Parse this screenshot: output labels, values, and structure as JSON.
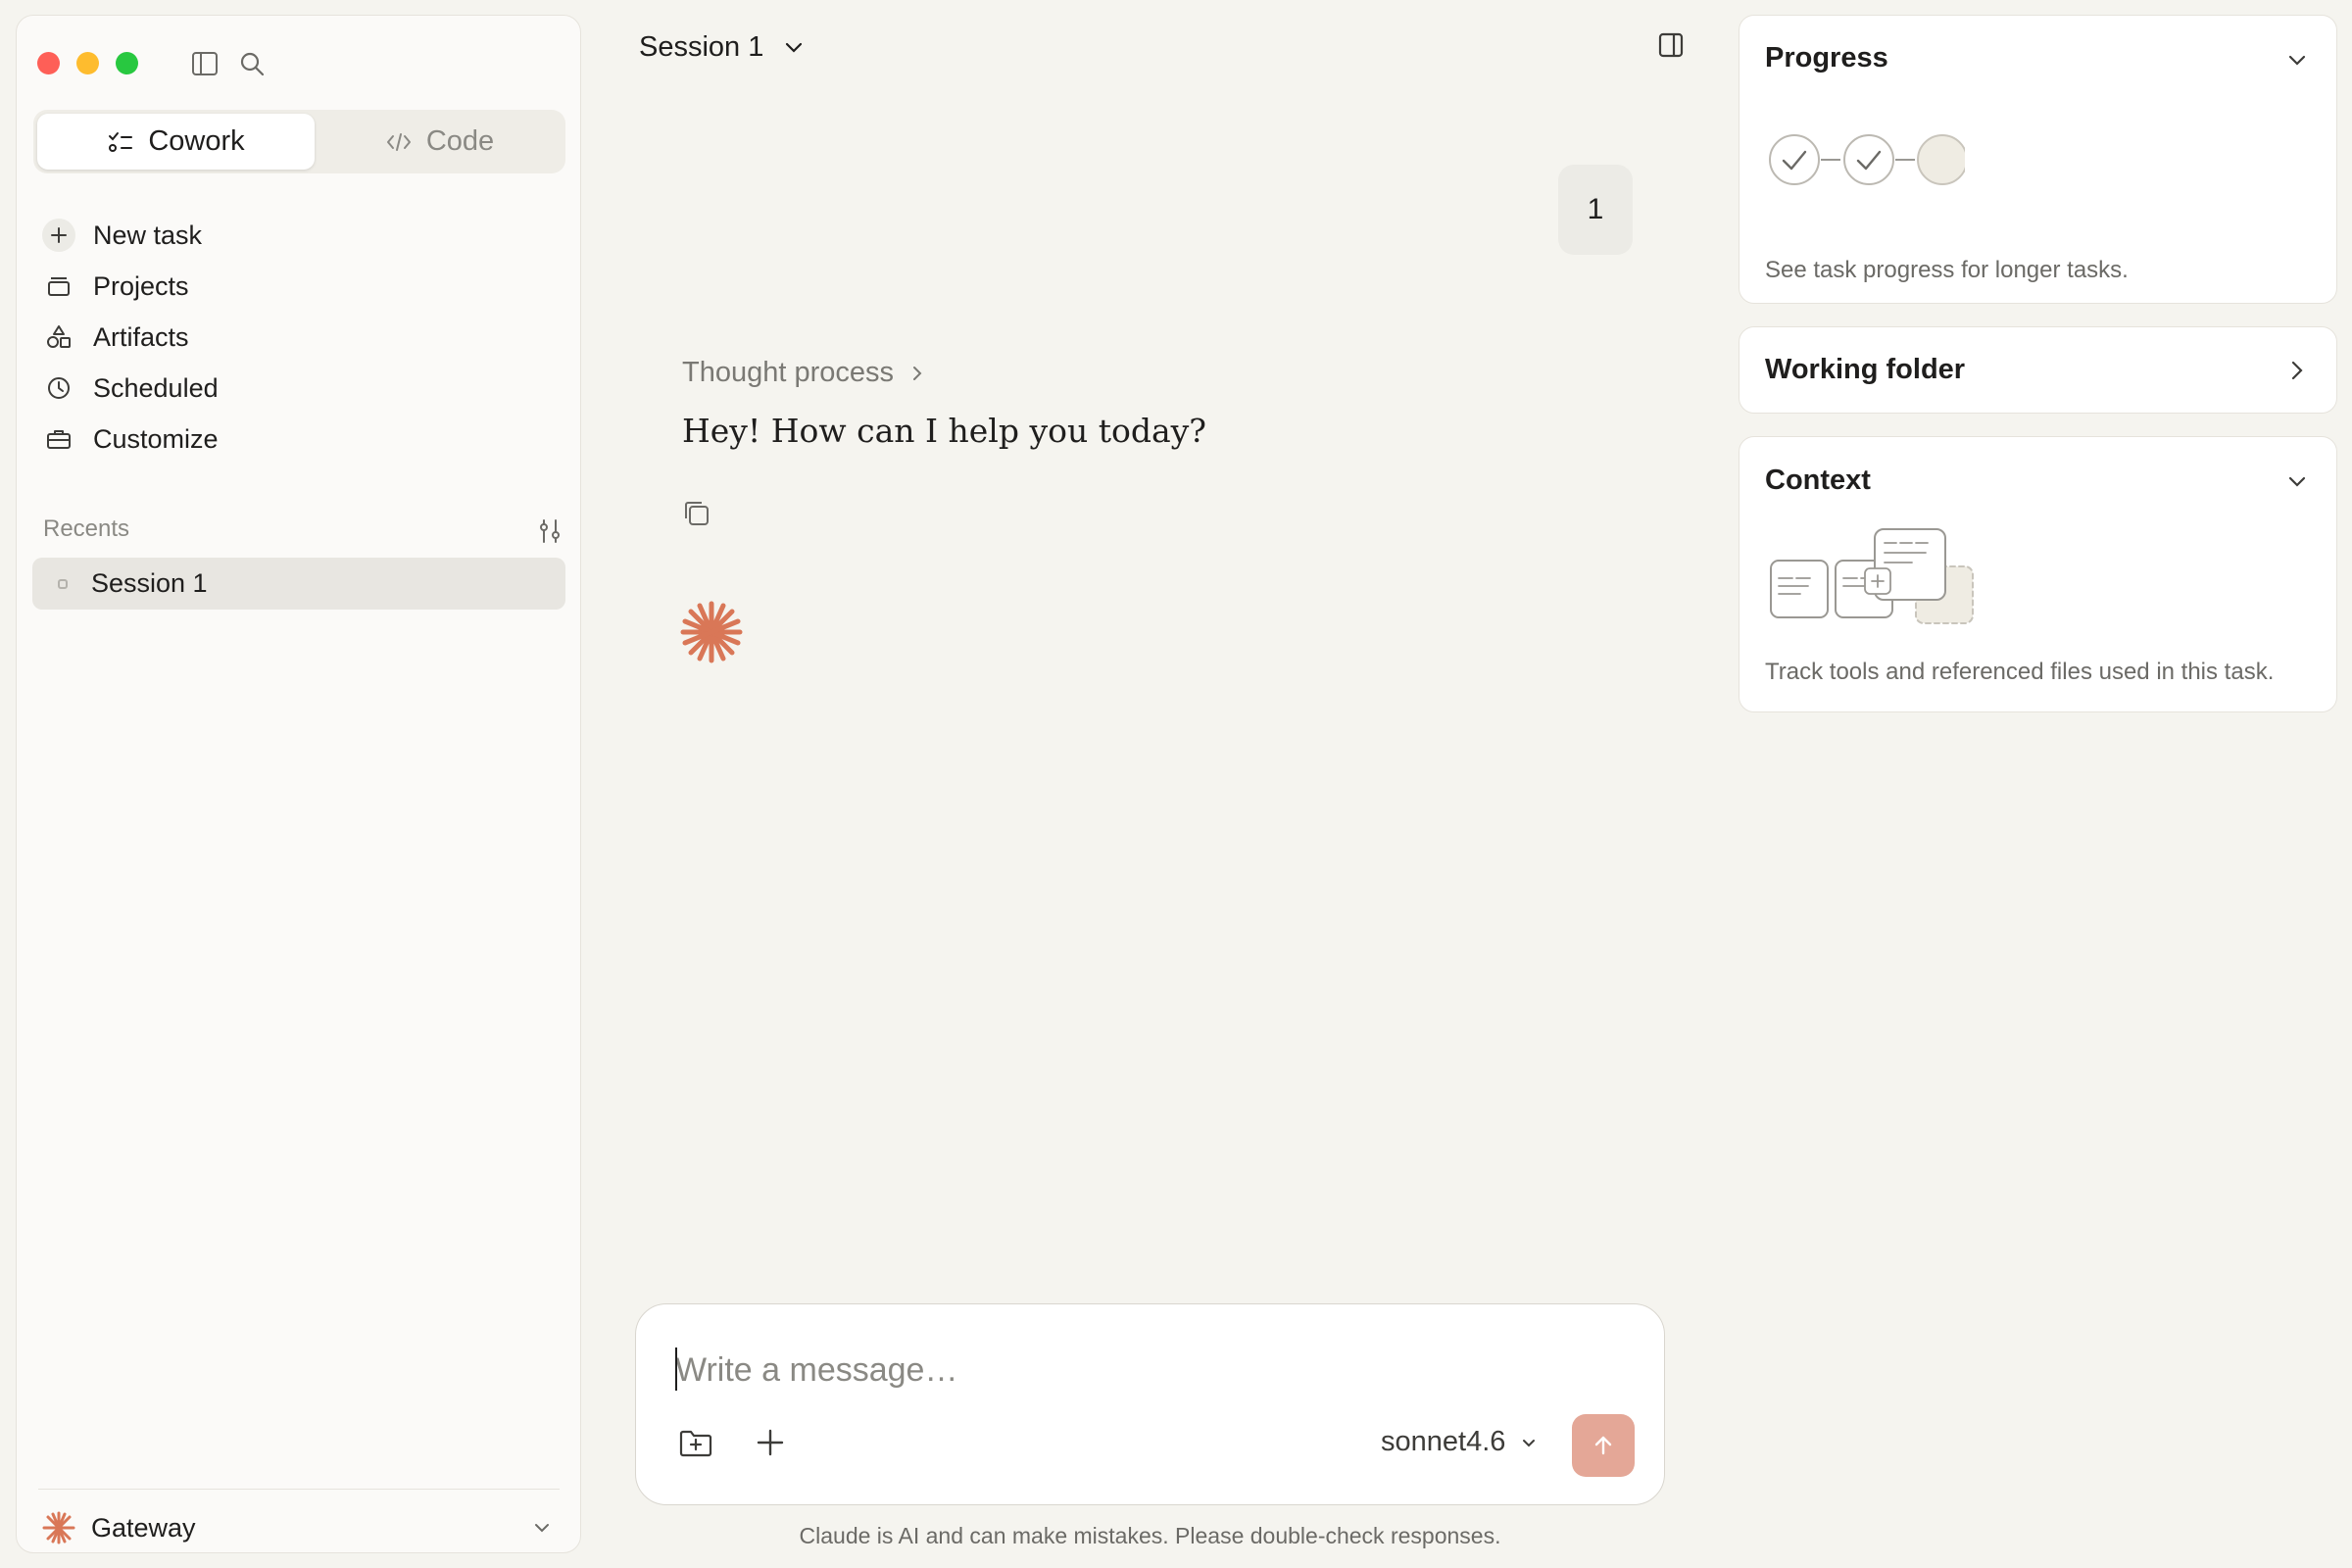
{
  "sidebar": {
    "modes": {
      "cowork": "Cowork",
      "code": "Code"
    },
    "nav": [
      {
        "label": "New task",
        "icon": "plus-icon"
      },
      {
        "label": "Projects",
        "icon": "folder-icon"
      },
      {
        "label": "Artifacts",
        "icon": "shapes-icon"
      },
      {
        "label": "Scheduled",
        "icon": "clock-icon"
      },
      {
        "label": "Customize",
        "icon": "briefcase-icon"
      }
    ],
    "recents_label": "Recents",
    "recents": [
      {
        "label": "Session 1"
      }
    ],
    "footer": {
      "label": "Gateway"
    }
  },
  "main": {
    "session_title": "Session 1",
    "user_message": "1",
    "thought_label": "Thought process",
    "reply": "Hey! How can I help you today?",
    "composer": {
      "placeholder": "Write a message…",
      "model": "sonnet4.6"
    },
    "disclaimer": "Claude is AI and can make mistakes. Please double-check responses."
  },
  "panel": {
    "progress": {
      "title": "Progress",
      "description": "See task progress for longer tasks."
    },
    "working_folder": {
      "title": "Working folder"
    },
    "context": {
      "title": "Context",
      "description": "Track tools and referenced files used in this task."
    }
  },
  "colors": {
    "accent": "#d97757",
    "send_button": "#e4a797",
    "background": "#f5f4ef"
  }
}
